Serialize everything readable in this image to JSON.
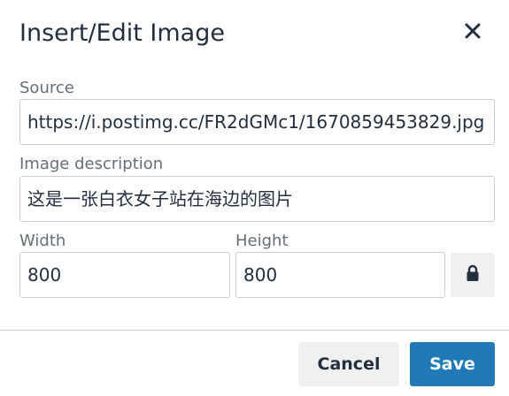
{
  "dialog": {
    "title": "Insert/Edit Image",
    "close_icon": "close-icon"
  },
  "source": {
    "label": "Source",
    "value": "https://i.postimg.cc/FR2dGMc1/1670859453829.jpg"
  },
  "description": {
    "label": "Image description",
    "value": "这是一张白衣女子站在海边的图片"
  },
  "dimensions": {
    "width_label": "Width",
    "width_value": "800",
    "height_label": "Height",
    "height_value": "800",
    "lock_icon": "lock-icon"
  },
  "footer": {
    "cancel_label": "Cancel",
    "save_label": "Save"
  },
  "colors": {
    "primary": "#207ab7",
    "secondary_button": "#f0f0f0",
    "text": "#222f3e",
    "border": "#cccccc"
  }
}
